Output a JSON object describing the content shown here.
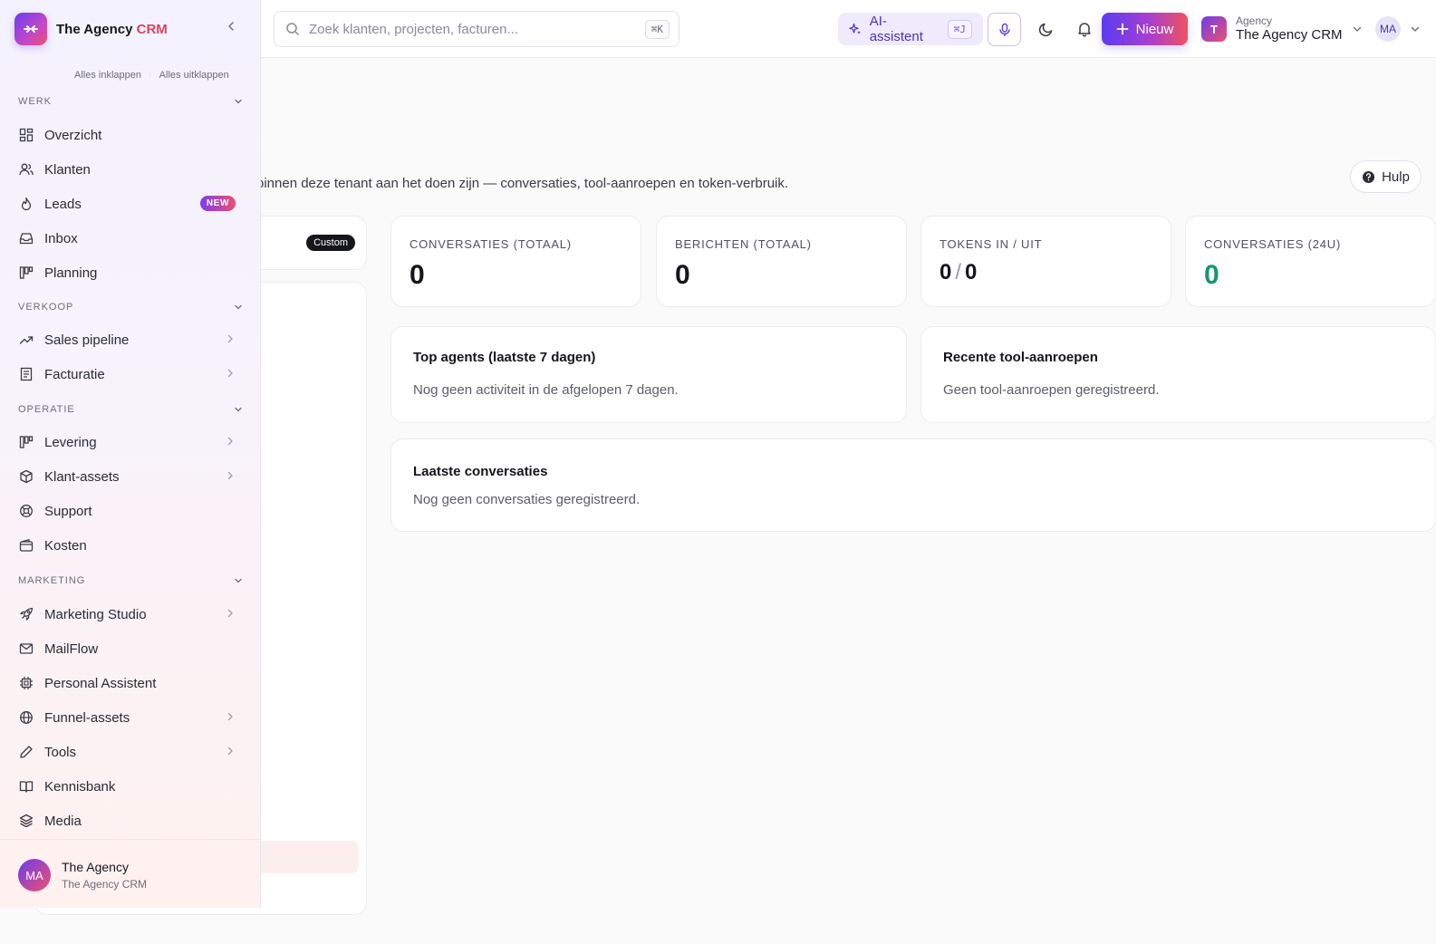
{
  "brand": {
    "name": "The Agency",
    "accent": "CRM"
  },
  "search": {
    "placeholder": "Zoek klanten, projecten, facturen...",
    "shortcut": "⌘K"
  },
  "header": {
    "ai_label": "AI-assistent",
    "ai_shortcut": "⌘J",
    "new_label": "Nieuw",
    "tenant_initial": "T",
    "tenant_kind": "Agency",
    "tenant_name": "The Agency CRM",
    "user_initials": "MA"
  },
  "sidebar": {
    "collapse_all": "Alles inklappen",
    "expand_all": "Alles uitklappen",
    "sections": {
      "werk": "WERK",
      "verkoop": "VERKOOP",
      "operatie": "OPERATIE",
      "marketing": "MARKETING"
    },
    "items": {
      "overzicht": "Overzicht",
      "klanten": "Klanten",
      "leads": "Leads",
      "leads_badge": "NEW",
      "inbox": "Inbox",
      "planning": "Planning",
      "sales_pipeline": "Sales pipeline",
      "facturatie": "Facturatie",
      "levering": "Levering",
      "klant_assets": "Klant-assets",
      "support": "Support",
      "kosten": "Kosten",
      "marketing_studio": "Marketing Studio",
      "mailflow": "MailFlow",
      "personal_assistent": "Personal Assistent",
      "funnel_assets": "Funnel-assets",
      "tools": "Tools",
      "kennisbank": "Kennisbank",
      "media": "Media"
    },
    "footer": {
      "initials": "MA",
      "name": "The Agency",
      "sub": "The Agency CRM"
    }
  },
  "main": {
    "subtitle": "binnen deze tenant aan het doen zijn — conversaties, tool-aanroepen en token-verbruik.",
    "help_label": "Hulp",
    "custom_badge": "Custom",
    "stats": {
      "conv_total_label": "CONVERSATIES (TOTAAL)",
      "conv_total_value": "0",
      "msgs_total_label": "BERICHTEN (TOTAAL)",
      "msgs_total_value": "0",
      "tokens_label": "TOKENS IN / UIT",
      "tokens_in": "0",
      "tokens_out": "0",
      "conv_24h_label": "CONVERSATIES (24U)",
      "conv_24h_value": "0"
    },
    "top_agents": {
      "title": "Top agents (laatste 7 dagen)",
      "empty": "Nog geen activiteit in de afgelopen 7 dagen."
    },
    "recent_tools": {
      "title": "Recente tool-aanroepen",
      "empty": "Geen tool-aanroepen geregistreerd."
    },
    "latest_conversations": {
      "title": "Laatste conversaties",
      "empty": "Nog geen conversaties geregistreerd."
    }
  },
  "colors": {
    "brand_purple": "#5b3cf0",
    "brand_pink": "#f0506a",
    "positive_green": "#14996a"
  }
}
